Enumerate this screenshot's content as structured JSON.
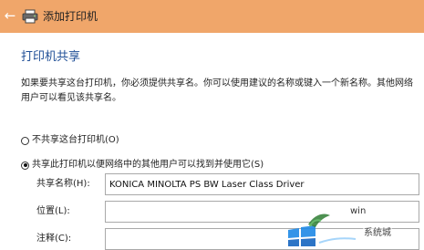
{
  "window": {
    "title": "添加打印机",
    "back_glyph": "←",
    "titlebar_color": "#f0a66a"
  },
  "section": {
    "heading": "打印机共享",
    "description": "如果要共享这台打印机，你必须提供共享名。你可以使用建议的名称或键入一个新名称。其他网络用户可以看见该共享名。"
  },
  "options": {
    "no_share_label": "不共享这台打印机(O)",
    "share_label": "共享此打印机以便网络中的其他用户可以找到并使用它(S)",
    "selected": "share"
  },
  "fields": {
    "share_name": {
      "label": "共享名称(H):",
      "value": "KONICA MINOLTA PS BW Laser Class Driver"
    },
    "location": {
      "label": "位置(L):",
      "value": ""
    },
    "comment": {
      "label": "注释(C):",
      "value": ""
    }
  },
  "watermark": {
    "text1": "win",
    "text2": "系统城"
  },
  "colors": {
    "accent": "#1f4e96",
    "titlebar": "#f0a66a"
  },
  "icons": {
    "back": "back-arrow-icon",
    "printer": "printer-icon",
    "watermark_logo": "windows-logo-icon"
  }
}
